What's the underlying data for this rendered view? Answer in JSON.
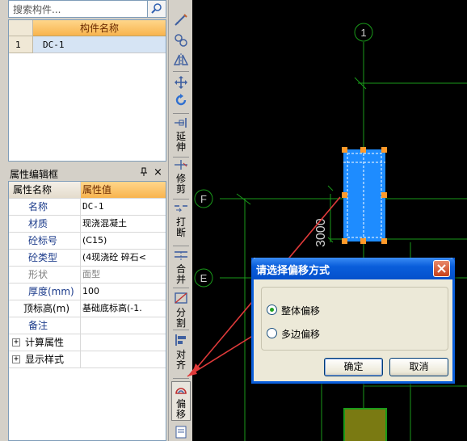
{
  "search": {
    "placeholder": "搜索构件..."
  },
  "component_list": {
    "column_header": "构件名称",
    "rows": [
      {
        "index": "1",
        "name": "DC-1"
      }
    ]
  },
  "property_panel": {
    "title": "属性编辑框",
    "pin_icon": "pin-icon",
    "close_glyph": "×",
    "header": {
      "name": "属性名称",
      "value": "属性值"
    },
    "rows": [
      {
        "name": "名称",
        "value": "DC-1"
      },
      {
        "name": "材质",
        "value": "现浇混凝土"
      },
      {
        "name": "砼标号",
        "value": "(C15)"
      },
      {
        "name": "砼类型",
        "value": "(4现浇砼 碎石<"
      },
      {
        "name": "形状",
        "value": "面型"
      },
      {
        "name": "厚度(mm)",
        "value": "100"
      },
      {
        "name": "顶标高(m)",
        "value": "基础底标高(-1."
      },
      {
        "name": "备注",
        "value": ""
      }
    ],
    "groups": [
      {
        "name": "计算属性"
      },
      {
        "name": "显示样式"
      }
    ]
  },
  "toolbar": {
    "extend_label": "延伸",
    "trim_label": "修剪",
    "break_label": "打断",
    "merge_label": "合并",
    "split_label": "分割",
    "align_label": "对齐",
    "offset_label": "偏移"
  },
  "canvas": {
    "axis_labels": [
      "1",
      "F",
      "E"
    ],
    "dimension_text": "3000",
    "colors": {
      "background": "#000000",
      "grid_green": "#1a9a1a",
      "selection_blue": "#1e8cff",
      "grip_orange": "#ff9a2a",
      "annotation_red": "#e03a3a",
      "footing_olive": "#7a7a12"
    }
  },
  "dialog": {
    "title": "请选择偏移方式",
    "options": [
      {
        "label": "整体偏移",
        "selected": true
      },
      {
        "label": "多边偏移",
        "selected": false
      }
    ],
    "ok_label": "确定",
    "cancel_label": "取消"
  }
}
